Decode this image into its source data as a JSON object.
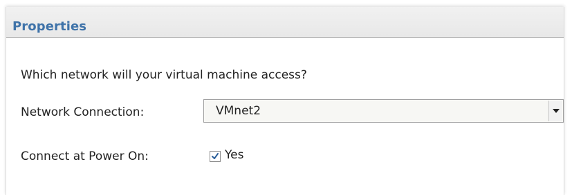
{
  "panel": {
    "title": "Properties",
    "question": "Which network will your virtual machine access?"
  },
  "network_connection": {
    "label": "Network Connection:",
    "selected_value": "VMnet2",
    "dropdown_icon": "chevron-down-icon"
  },
  "connect_at_power_on": {
    "label": "Connect at Power On:",
    "checkbox_label": "Yes",
    "checked": true,
    "check_icon": "checkmark-icon"
  },
  "colors": {
    "title": "#3f73a9",
    "text": "#222222",
    "header_background": "#eeeeee",
    "border": "#9f9f9f"
  }
}
